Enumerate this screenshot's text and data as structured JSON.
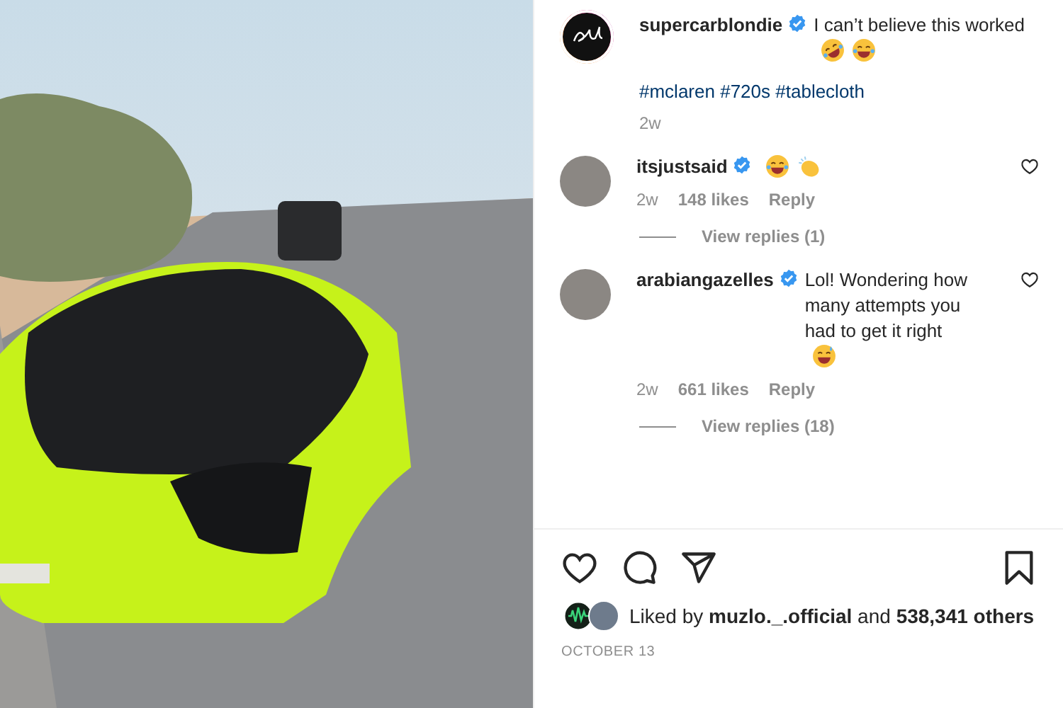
{
  "post": {
    "author": "supercarblondie",
    "verified": true,
    "caption": "I can’t believe this worked",
    "reactions": [
      {
        "kind": "rofl"
      },
      {
        "kind": "joy"
      }
    ],
    "hashtags": [
      "#mclaren",
      "#720s",
      "#tablecloth"
    ],
    "time": "2w"
  },
  "comments": [
    {
      "user": "itsjustsaid",
      "verified": true,
      "reactions": [
        {
          "kind": "joy"
        },
        {
          "kind": "clap"
        }
      ],
      "time": "2w",
      "likes": "148 likes",
      "reply": "Reply",
      "liked": false,
      "view_replies": "View replies (1)"
    },
    {
      "user": "arabiangazelles",
      "verified": true,
      "text": "Lol! Wondering how many attempts you had to get it right",
      "reactions": [
        {
          "kind": "sweat"
        }
      ],
      "time": "2w",
      "likes": "661 likes",
      "reply": "Reply",
      "liked": false,
      "view_replies": "View replies (18)"
    }
  ],
  "actions": {
    "liked": false,
    "saved": false
  },
  "likes": "Liked by **muzlo._.official** and **538,341 others**",
  "date": "OCTOBER 13"
}
